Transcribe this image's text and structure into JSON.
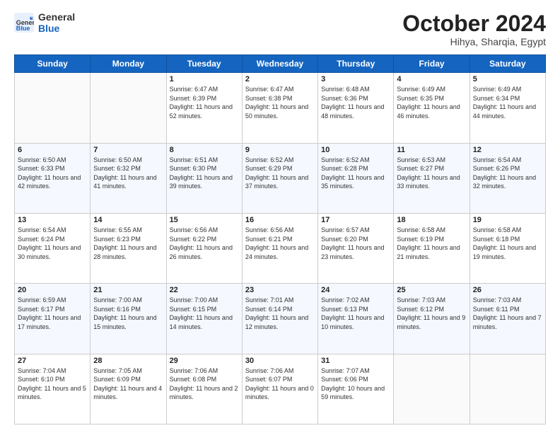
{
  "header": {
    "logo_general": "General",
    "logo_blue": "Blue",
    "month_title": "October 2024",
    "location": "Hihya, Sharqia, Egypt"
  },
  "days_of_week": [
    "Sunday",
    "Monday",
    "Tuesday",
    "Wednesday",
    "Thursday",
    "Friday",
    "Saturday"
  ],
  "weeks": [
    [
      {
        "day": "",
        "sunrise": "",
        "sunset": "",
        "daylight": ""
      },
      {
        "day": "",
        "sunrise": "",
        "sunset": "",
        "daylight": ""
      },
      {
        "day": "1",
        "sunrise": "Sunrise: 6:47 AM",
        "sunset": "Sunset: 6:39 PM",
        "daylight": "Daylight: 11 hours and 52 minutes."
      },
      {
        "day": "2",
        "sunrise": "Sunrise: 6:47 AM",
        "sunset": "Sunset: 6:38 PM",
        "daylight": "Daylight: 11 hours and 50 minutes."
      },
      {
        "day": "3",
        "sunrise": "Sunrise: 6:48 AM",
        "sunset": "Sunset: 6:36 PM",
        "daylight": "Daylight: 11 hours and 48 minutes."
      },
      {
        "day": "4",
        "sunrise": "Sunrise: 6:49 AM",
        "sunset": "Sunset: 6:35 PM",
        "daylight": "Daylight: 11 hours and 46 minutes."
      },
      {
        "day": "5",
        "sunrise": "Sunrise: 6:49 AM",
        "sunset": "Sunset: 6:34 PM",
        "daylight": "Daylight: 11 hours and 44 minutes."
      }
    ],
    [
      {
        "day": "6",
        "sunrise": "Sunrise: 6:50 AM",
        "sunset": "Sunset: 6:33 PM",
        "daylight": "Daylight: 11 hours and 42 minutes."
      },
      {
        "day": "7",
        "sunrise": "Sunrise: 6:50 AM",
        "sunset": "Sunset: 6:32 PM",
        "daylight": "Daylight: 11 hours and 41 minutes."
      },
      {
        "day": "8",
        "sunrise": "Sunrise: 6:51 AM",
        "sunset": "Sunset: 6:30 PM",
        "daylight": "Daylight: 11 hours and 39 minutes."
      },
      {
        "day": "9",
        "sunrise": "Sunrise: 6:52 AM",
        "sunset": "Sunset: 6:29 PM",
        "daylight": "Daylight: 11 hours and 37 minutes."
      },
      {
        "day": "10",
        "sunrise": "Sunrise: 6:52 AM",
        "sunset": "Sunset: 6:28 PM",
        "daylight": "Daylight: 11 hours and 35 minutes."
      },
      {
        "day": "11",
        "sunrise": "Sunrise: 6:53 AM",
        "sunset": "Sunset: 6:27 PM",
        "daylight": "Daylight: 11 hours and 33 minutes."
      },
      {
        "day": "12",
        "sunrise": "Sunrise: 6:54 AM",
        "sunset": "Sunset: 6:26 PM",
        "daylight": "Daylight: 11 hours and 32 minutes."
      }
    ],
    [
      {
        "day": "13",
        "sunrise": "Sunrise: 6:54 AM",
        "sunset": "Sunset: 6:24 PM",
        "daylight": "Daylight: 11 hours and 30 minutes."
      },
      {
        "day": "14",
        "sunrise": "Sunrise: 6:55 AM",
        "sunset": "Sunset: 6:23 PM",
        "daylight": "Daylight: 11 hours and 28 minutes."
      },
      {
        "day": "15",
        "sunrise": "Sunrise: 6:56 AM",
        "sunset": "Sunset: 6:22 PM",
        "daylight": "Daylight: 11 hours and 26 minutes."
      },
      {
        "day": "16",
        "sunrise": "Sunrise: 6:56 AM",
        "sunset": "Sunset: 6:21 PM",
        "daylight": "Daylight: 11 hours and 24 minutes."
      },
      {
        "day": "17",
        "sunrise": "Sunrise: 6:57 AM",
        "sunset": "Sunset: 6:20 PM",
        "daylight": "Daylight: 11 hours and 23 minutes."
      },
      {
        "day": "18",
        "sunrise": "Sunrise: 6:58 AM",
        "sunset": "Sunset: 6:19 PM",
        "daylight": "Daylight: 11 hours and 21 minutes."
      },
      {
        "day": "19",
        "sunrise": "Sunrise: 6:58 AM",
        "sunset": "Sunset: 6:18 PM",
        "daylight": "Daylight: 11 hours and 19 minutes."
      }
    ],
    [
      {
        "day": "20",
        "sunrise": "Sunrise: 6:59 AM",
        "sunset": "Sunset: 6:17 PM",
        "daylight": "Daylight: 11 hours and 17 minutes."
      },
      {
        "day": "21",
        "sunrise": "Sunrise: 7:00 AM",
        "sunset": "Sunset: 6:16 PM",
        "daylight": "Daylight: 11 hours and 15 minutes."
      },
      {
        "day": "22",
        "sunrise": "Sunrise: 7:00 AM",
        "sunset": "Sunset: 6:15 PM",
        "daylight": "Daylight: 11 hours and 14 minutes."
      },
      {
        "day": "23",
        "sunrise": "Sunrise: 7:01 AM",
        "sunset": "Sunset: 6:14 PM",
        "daylight": "Daylight: 11 hours and 12 minutes."
      },
      {
        "day": "24",
        "sunrise": "Sunrise: 7:02 AM",
        "sunset": "Sunset: 6:13 PM",
        "daylight": "Daylight: 11 hours and 10 minutes."
      },
      {
        "day": "25",
        "sunrise": "Sunrise: 7:03 AM",
        "sunset": "Sunset: 6:12 PM",
        "daylight": "Daylight: 11 hours and 9 minutes."
      },
      {
        "day": "26",
        "sunrise": "Sunrise: 7:03 AM",
        "sunset": "Sunset: 6:11 PM",
        "daylight": "Daylight: 11 hours and 7 minutes."
      }
    ],
    [
      {
        "day": "27",
        "sunrise": "Sunrise: 7:04 AM",
        "sunset": "Sunset: 6:10 PM",
        "daylight": "Daylight: 11 hours and 5 minutes."
      },
      {
        "day": "28",
        "sunrise": "Sunrise: 7:05 AM",
        "sunset": "Sunset: 6:09 PM",
        "daylight": "Daylight: 11 hours and 4 minutes."
      },
      {
        "day": "29",
        "sunrise": "Sunrise: 7:06 AM",
        "sunset": "Sunset: 6:08 PM",
        "daylight": "Daylight: 11 hours and 2 minutes."
      },
      {
        "day": "30",
        "sunrise": "Sunrise: 7:06 AM",
        "sunset": "Sunset: 6:07 PM",
        "daylight": "Daylight: 11 hours and 0 minutes."
      },
      {
        "day": "31",
        "sunrise": "Sunrise: 7:07 AM",
        "sunset": "Sunset: 6:06 PM",
        "daylight": "Daylight: 10 hours and 59 minutes."
      },
      {
        "day": "",
        "sunrise": "",
        "sunset": "",
        "daylight": ""
      },
      {
        "day": "",
        "sunrise": "",
        "sunset": "",
        "daylight": ""
      }
    ]
  ]
}
